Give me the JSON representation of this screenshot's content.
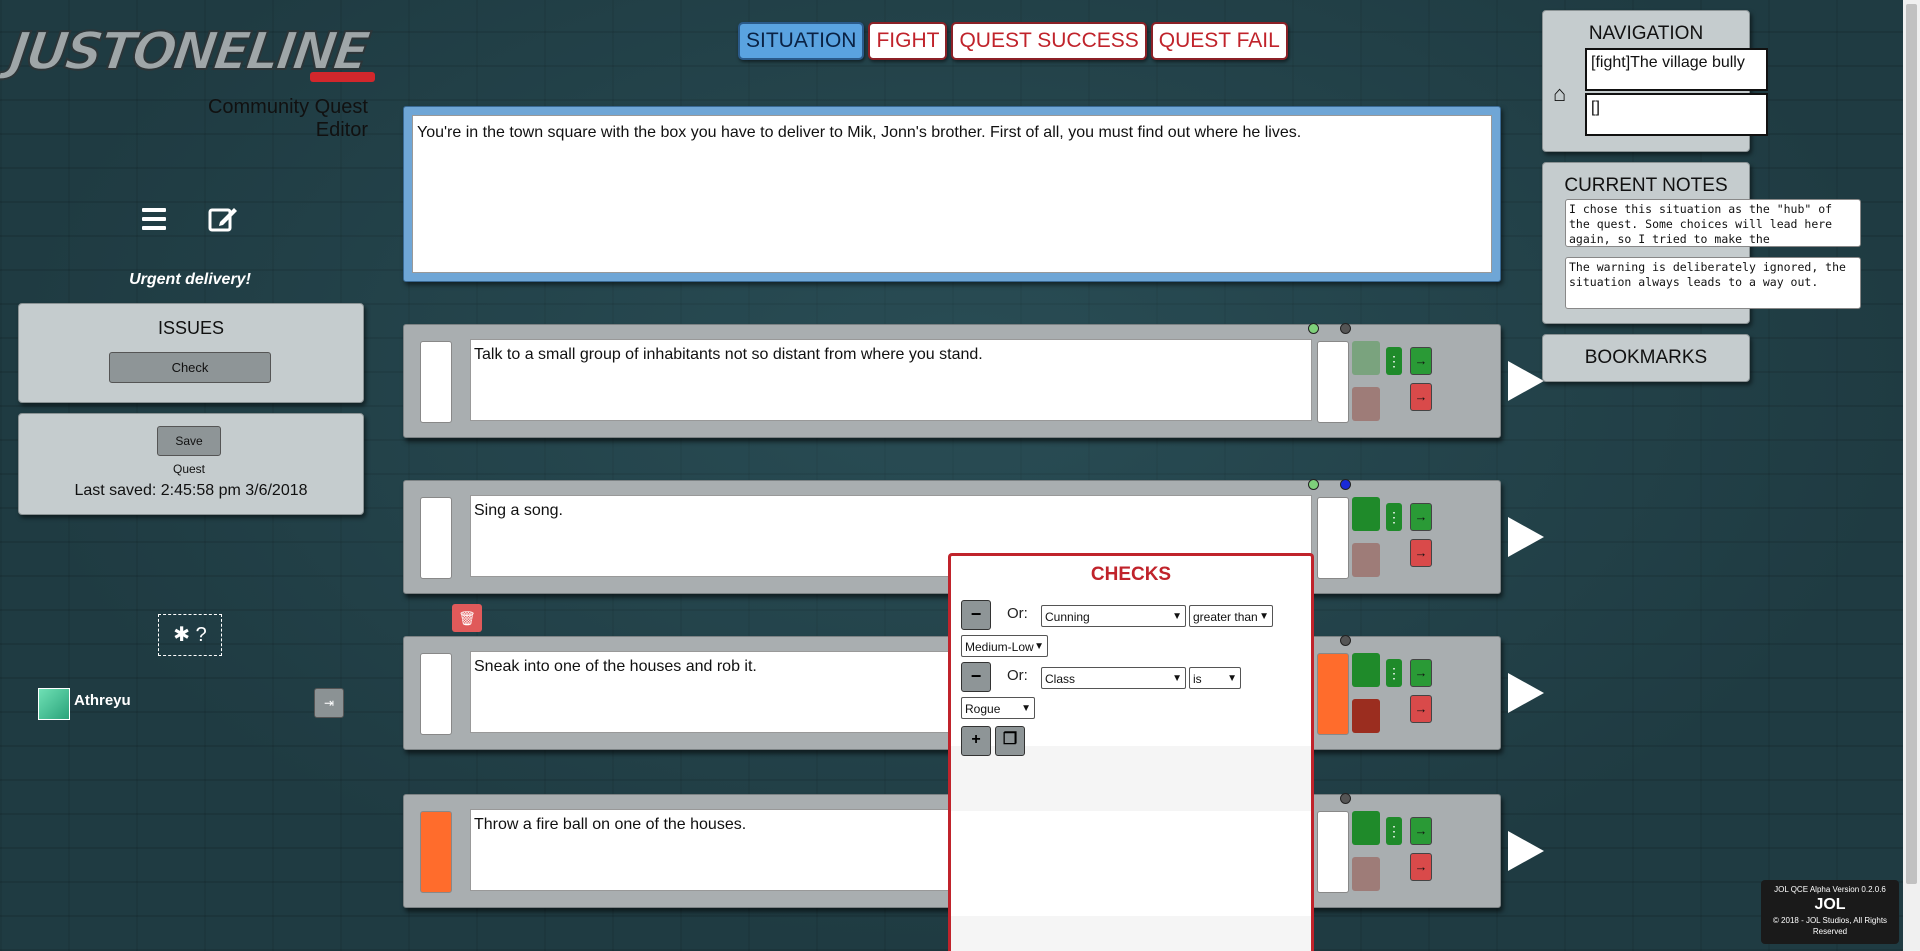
{
  "app": {
    "logo_text": "JUSTONELINE",
    "subtitle": "Community Quest Editor",
    "quest_title": "Urgent delivery!",
    "icons": [
      "menu-icon",
      "edit-icon",
      "bug-icon",
      "help-icon",
      "logout-icon",
      "home-icon",
      "trash-icon"
    ]
  },
  "sidebar": {
    "issues": {
      "title": "ISSUES",
      "check_label": "Check"
    },
    "save": {
      "button_label": "Save Quest",
      "last_saved": "Last saved: 2:45:58 pm 3/6/2018"
    },
    "help_glyphs": "✱ ?",
    "user": {
      "name": "Athreyu"
    }
  },
  "tabs": [
    {
      "label": "SITUATION",
      "active": true
    },
    {
      "label": "FIGHT",
      "active": false
    },
    {
      "label": "QUEST SUCCESS",
      "active": false
    },
    {
      "label": "QUEST FAIL",
      "active": false
    }
  ],
  "situation": {
    "text": "You're in the town square with the box you have to deliver to Mik, Jonn's brother. First of all, you must find out where he lives."
  },
  "choices": [
    {
      "text": "Talk to a small group of inhabitants not so distant from where you stand."
    },
    {
      "text": "Sing a song."
    },
    {
      "text": "Sneak into one of the houses and rob it."
    },
    {
      "text": "Throw a fire ball on one of the houses."
    }
  ],
  "checks": {
    "title": "CHECKS",
    "rows": [
      {
        "or_label": "Or:",
        "attribute": "Cunning",
        "operator": "greater than",
        "value": "Medium-Low"
      },
      {
        "or_label": "Or:",
        "attribute": "Class",
        "operator": "is",
        "value": "Rogue"
      }
    ],
    "minus_glyph": "−",
    "add_glyph": "+",
    "copy_glyph": "❐"
  },
  "navigation": {
    "title": "NAVIGATION",
    "items": [
      "[fight]The village bully",
      "[]"
    ]
  },
  "notes": {
    "title": "CURRENT NOTES",
    "note1": "I chose this situation as the \"hub\" of the quest. Some choices will lead here again, so I tried to make the",
    "note2": "The warning is deliberately ignored, the situation always leads to a way out."
  },
  "bookmarks": {
    "title": "BOOKMARKS"
  },
  "version": {
    "line1": "JOL QCE Alpha Version 0.2.0.6",
    "logo": "JOL",
    "line2": "© 2018 - JOL Studios, All Rights Reserved"
  },
  "colors": {
    "tab_active": "#5aa3e0",
    "tab_text": "#c0232b",
    "situation_frame": "#6fa6d6",
    "choice_panel": "#a9aeb0",
    "orange": "#ff6c2c",
    "green": "#1f8a2a",
    "red": "#d94a4a"
  }
}
